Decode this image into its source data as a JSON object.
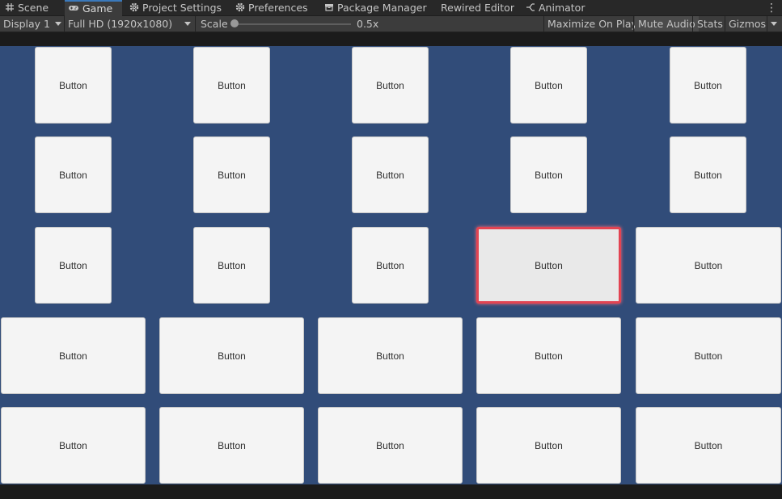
{
  "tabs": [
    {
      "label": "Scene",
      "icon": "grid-icon"
    },
    {
      "label": "Game",
      "icon": "gamepad-icon"
    },
    {
      "label": "Project Settings",
      "icon": "gear-icon"
    },
    {
      "label": "Preferences",
      "icon": "gear-icon"
    },
    {
      "label": "Package Manager",
      "icon": "package-icon"
    },
    {
      "label": "Rewired Editor",
      "icon": ""
    },
    {
      "label": "Animator",
      "icon": "animator-icon"
    }
  ],
  "active_tab": "Game",
  "toolbar": {
    "display": "Display 1",
    "resolution": "Full HD (1920x1080)",
    "scale_label": "Scale",
    "scale_value": "0.5x",
    "maximize_on_play": "Maximize On Play",
    "mute_audio": "Mute Audio",
    "stats": "Stats",
    "gizmos": "Gizmos"
  },
  "game": {
    "background_color": "#314c79",
    "button_label": "Button",
    "selected_button": {
      "row": 2,
      "column": 3
    },
    "selection_color": "#e24452",
    "rows": [
      [
        "Button",
        "Button",
        "Button",
        "Button",
        "Button"
      ],
      [
        "Button",
        "Button",
        "Button",
        "Button",
        "Button"
      ],
      [
        "Button",
        "Button",
        "Button",
        "Button",
        "Button"
      ],
      [
        "Button",
        "Button",
        "Button",
        "Button",
        "Button"
      ],
      [
        "Button",
        "Button",
        "Button",
        "Button",
        "Button"
      ]
    ]
  }
}
